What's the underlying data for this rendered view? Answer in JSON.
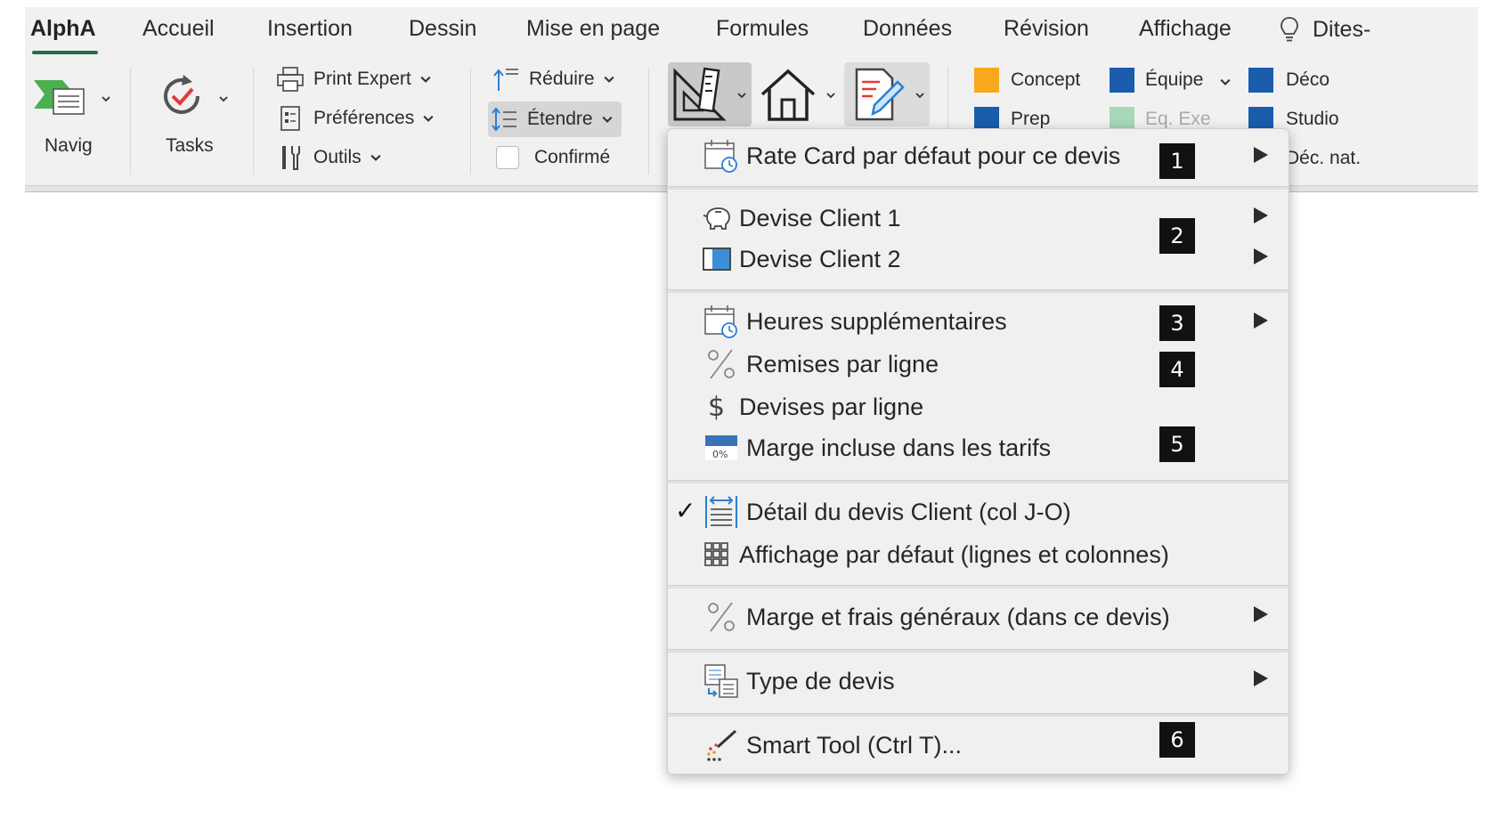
{
  "tabs": [
    "AlphA",
    "Accueil",
    "Insertion",
    "Dessin",
    "Mise en page",
    "Formules",
    "Données",
    "Révision",
    "Affichage"
  ],
  "tell_me": "Dites-",
  "ribbon": {
    "navig_label": "Navig",
    "tasks_label": "Tasks",
    "print_expert": "Print Expert",
    "preferences": "Préférences",
    "outils": "Outils",
    "reduire": "Réduire",
    "etendre": "Étendre",
    "confirme": "Confirmé",
    "tags": [
      {
        "label": "Concept",
        "color": "#f7a81b"
      },
      {
        "label": "Équipe",
        "color": "#1a5dad"
      },
      {
        "label": "Déco",
        "color": "#1a5dad"
      },
      {
        "label": "Prep",
        "color": "#1a5dad"
      },
      {
        "label": "Eq. Exe",
        "color": "#a7d8b7"
      },
      {
        "label": "Studio",
        "color": "#1a5dad"
      },
      {
        "label": "Déc. nat.",
        "color": "#1a5dad"
      }
    ]
  },
  "menu": {
    "items": [
      {
        "label": "Rate Card par défaut pour ce devis"
      },
      {
        "label": "Devise Client 1"
      },
      {
        "label": "Devise Client 2"
      },
      {
        "label": "Heures supplémentaires"
      },
      {
        "label": "Remises par ligne"
      },
      {
        "label": "Devises par ligne"
      },
      {
        "label": "Marge incluse dans les tarifs"
      },
      {
        "label": "Détail du devis Client (col J-O)"
      },
      {
        "label": "Affichage par défaut (lignes et colonnes)"
      },
      {
        "label": "Marge et frais généraux (dans ce devis)"
      },
      {
        "label": "Type de devis"
      },
      {
        "label": "Smart Tool (Ctrl T)..."
      }
    ],
    "checkmark": "✓",
    "margin_icon_text": "0%",
    "badges": [
      "1",
      "2",
      "3",
      "4",
      "5",
      "6"
    ]
  }
}
